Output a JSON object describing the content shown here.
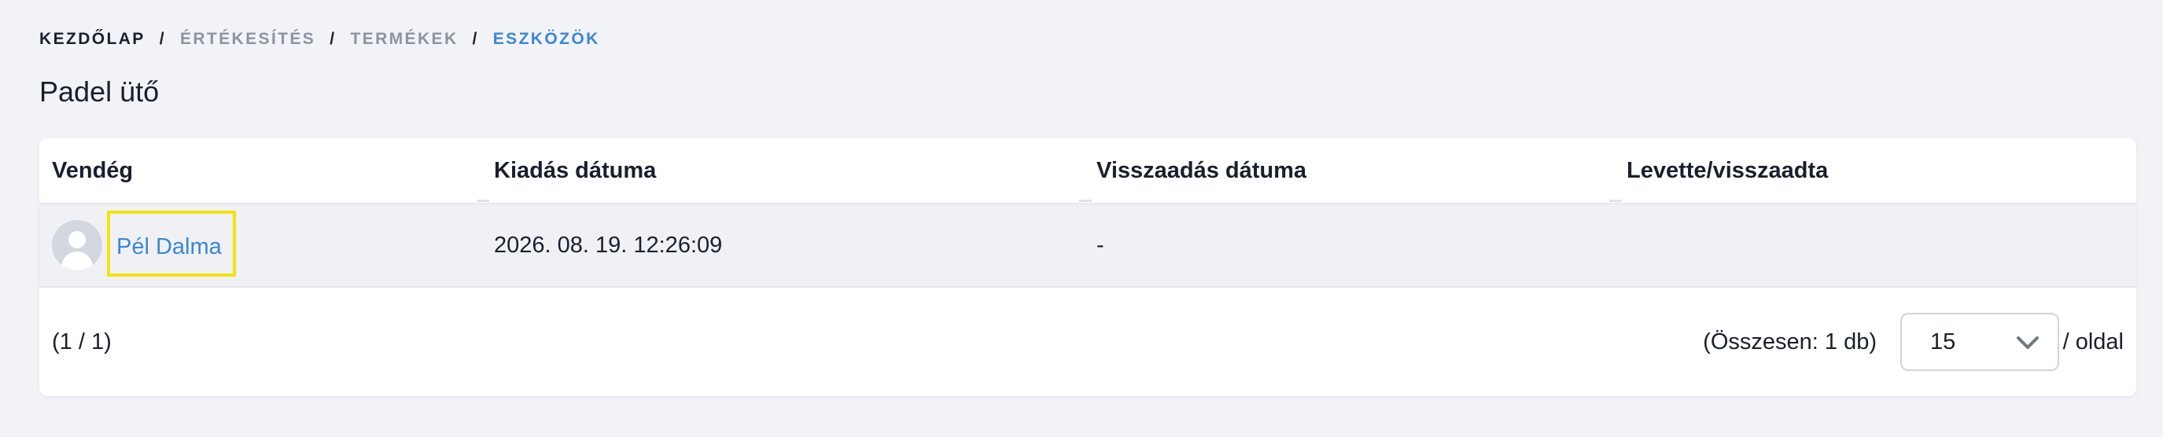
{
  "breadcrumb": {
    "items": [
      "KEZDŐLAP",
      "ÉRTÉKESÍTÉS",
      "TERMÉKEK",
      "ESZKÖZÖK"
    ],
    "separator": "/"
  },
  "page": {
    "title": "Padel ütő"
  },
  "table": {
    "columns": [
      "Vendég",
      "Kiadás dátuma",
      "Visszaadás dátuma",
      "Levette/visszaadta"
    ],
    "rows": [
      {
        "guest": "Pél Dalma",
        "avatar": "avatar-placeholder-icon",
        "issue_date": "2026. 08. 19. 12:26:09",
        "return_date": "-",
        "handled_by": ""
      }
    ]
  },
  "pagination": {
    "page_info": "(1 / 1)",
    "total": "(Összesen: 1 db)",
    "per_page_value": "15",
    "per_page_suffix": "/ oldal"
  },
  "colors": {
    "background": "#f2f3f7",
    "link": "#3a87d4",
    "highlight": "#f2e30f",
    "breadcrumb_muted": "#8a93a3"
  }
}
